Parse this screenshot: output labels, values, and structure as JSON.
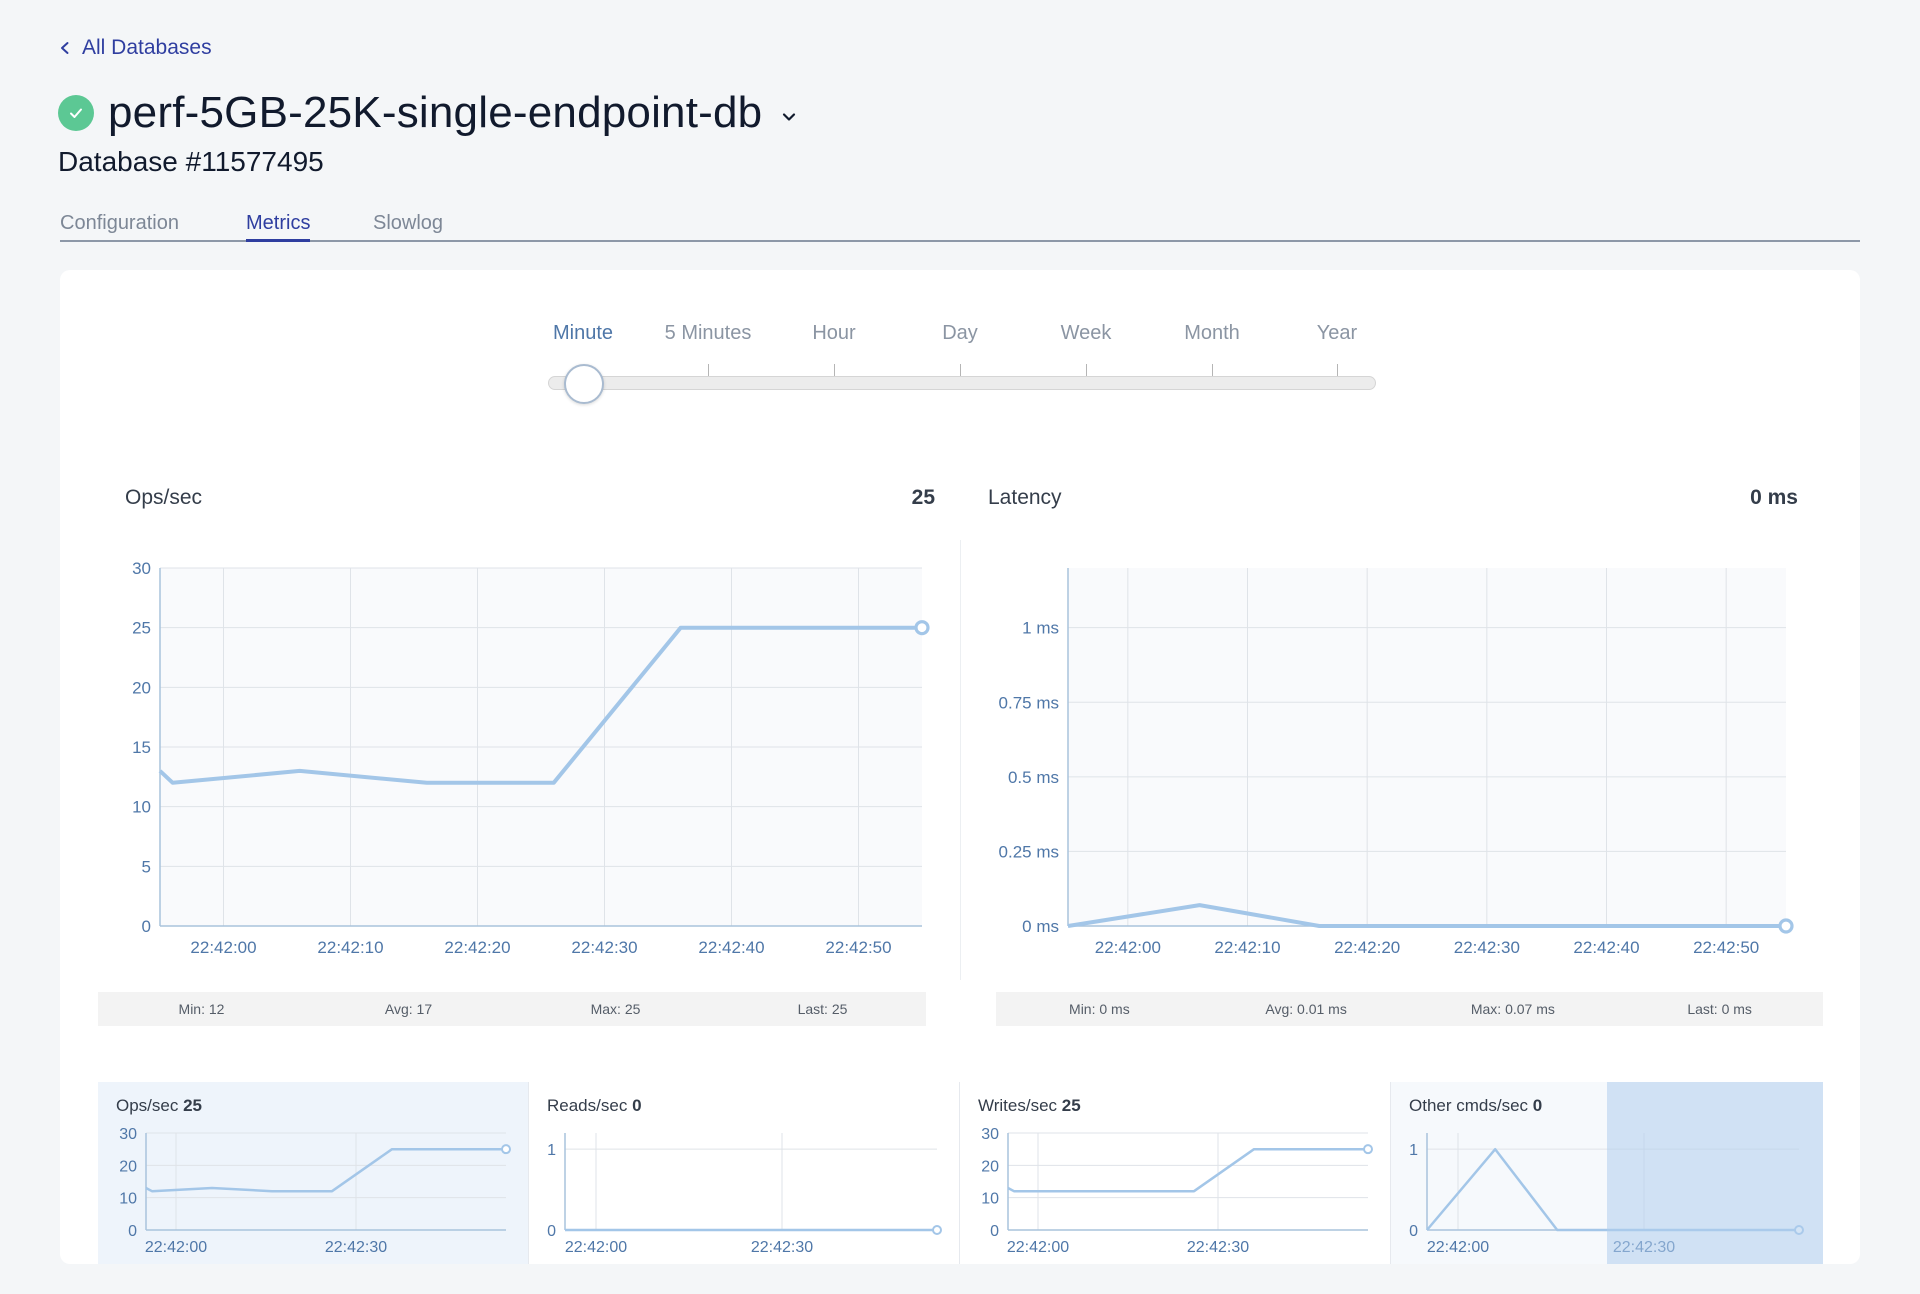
{
  "nav": {
    "back_label": "All Databases"
  },
  "database": {
    "title": "perf-5GB-25K-single-endpoint-db",
    "subtitle": "Database #11577495",
    "status_color": "#5cc894"
  },
  "tabs": [
    {
      "label": "Configuration",
      "active": false
    },
    {
      "label": "Metrics",
      "active": true
    },
    {
      "label": "Slowlog",
      "active": false
    }
  ],
  "time_range": {
    "options": [
      "Minute",
      "5 Minutes",
      "Hour",
      "Day",
      "Week",
      "Month",
      "Year"
    ],
    "selected": "Minute"
  },
  "charts": {
    "ops": {
      "title": "Ops/sec",
      "current_value": "25",
      "stats": {
        "min": "Min: ",
        "min_value": "12",
        "avg": "Avg: ",
        "avg_value": "17",
        "max": "Max: ",
        "max_value": "25",
        "last": "Last: ",
        "last_value": "25"
      }
    },
    "latency": {
      "title": "Latency",
      "current_value": "0 ms",
      "stats": {
        "min": "Min: ",
        "min_value": "0 ms",
        "avg": "Avg: ",
        "avg_value": "0.01 ms",
        "max": "Max: ",
        "max_value": "0.07 ms",
        "last": "Last: ",
        "last_value": "0 ms"
      }
    }
  },
  "mini_charts": [
    {
      "title": "Ops/sec",
      "value": "25",
      "selected": true
    },
    {
      "title": "Reads/sec",
      "value": "0",
      "selected": false
    },
    {
      "title": "Writes/sec",
      "value": "25",
      "selected": false
    },
    {
      "title": "Other cmds/sec",
      "value": "0",
      "selected": false
    }
  ],
  "chart_data": [
    {
      "type": "line",
      "title": "Ops/sec",
      "x": [
        "22:41:55",
        "22:41:56",
        "22:42:06",
        "22:42:16",
        "22:42:26",
        "22:42:36",
        "22:42:46",
        "22:42:55"
      ],
      "series": [
        {
          "values": [
            13,
            12,
            13,
            12,
            12,
            25,
            25,
            25
          ]
        }
      ],
      "x_ticks": [
        "22:42:00",
        "22:42:10",
        "22:42:20",
        "22:42:30",
        "22:42:40",
        "22:42:50"
      ],
      "y_ticks": [
        0,
        5,
        10,
        15,
        20,
        25,
        30
      ],
      "ylim": [
        0,
        30
      ],
      "grid": true,
      "color": "#a3c6e8"
    },
    {
      "type": "line",
      "title": "Latency",
      "x": [
        "22:41:55",
        "22:42:06",
        "22:42:16",
        "22:42:26",
        "22:42:36",
        "22:42:46",
        "22:42:55"
      ],
      "series": [
        {
          "values": [
            0,
            0.07,
            0,
            0,
            0,
            0,
            0
          ]
        }
      ],
      "x_ticks": [
        "22:42:00",
        "22:42:10",
        "22:42:20",
        "22:42:30",
        "22:42:40",
        "22:42:50"
      ],
      "y_ticks": [
        "0 ms",
        "0.25 ms",
        "0.5 ms",
        "0.75 ms",
        "1 ms"
      ],
      "ylim": [
        0,
        1.2
      ],
      "grid": true,
      "color": "#a3c6e8"
    },
    {
      "type": "line",
      "title": "Ops/sec",
      "x": [
        "22:41:55",
        "22:41:56",
        "22:42:06",
        "22:42:16",
        "22:42:26",
        "22:42:36",
        "22:42:46",
        "22:42:55"
      ],
      "series": [
        {
          "values": [
            13,
            12,
            13,
            12,
            12,
            25,
            25,
            25
          ]
        }
      ],
      "x_ticks": [
        "22:42:00",
        "22:42:30"
      ],
      "y_ticks": [
        0,
        10,
        20,
        30
      ],
      "ylim": [
        0,
        30
      ],
      "color": "#a3c6e8"
    },
    {
      "type": "line",
      "title": "Reads/sec",
      "x": [
        "22:41:55",
        "22:42:55"
      ],
      "series": [
        {
          "values": [
            0,
            0
          ]
        }
      ],
      "x_ticks": [
        "22:42:00",
        "22:42:30"
      ],
      "y_ticks": [
        0,
        1
      ],
      "ylim": [
        0,
        1.2
      ],
      "color": "#a3c6e8"
    },
    {
      "type": "line",
      "title": "Writes/sec",
      "x": [
        "22:41:55",
        "22:41:56",
        "22:42:06",
        "22:42:16",
        "22:42:26",
        "22:42:36",
        "22:42:46",
        "22:42:55"
      ],
      "series": [
        {
          "values": [
            13,
            12,
            12,
            12,
            12,
            25,
            25,
            25
          ]
        }
      ],
      "x_ticks": [
        "22:42:00",
        "22:42:30"
      ],
      "y_ticks": [
        0,
        10,
        20,
        30
      ],
      "ylim": [
        0,
        30
      ],
      "color": "#a3c6e8"
    },
    {
      "type": "line",
      "title": "Other cmds/sec",
      "x": [
        "22:41:55",
        "22:42:06",
        "22:42:16",
        "22:42:26",
        "22:42:36",
        "22:42:46",
        "22:42:55"
      ],
      "series": [
        {
          "values": [
            0,
            1,
            0,
            0,
            0,
            0,
            0
          ]
        }
      ],
      "x_ticks": [
        "22:42:00",
        "22:42:30"
      ],
      "y_ticks": [
        0,
        1
      ],
      "ylim": [
        0,
        1.2
      ],
      "color": "#a3c6e8"
    }
  ]
}
